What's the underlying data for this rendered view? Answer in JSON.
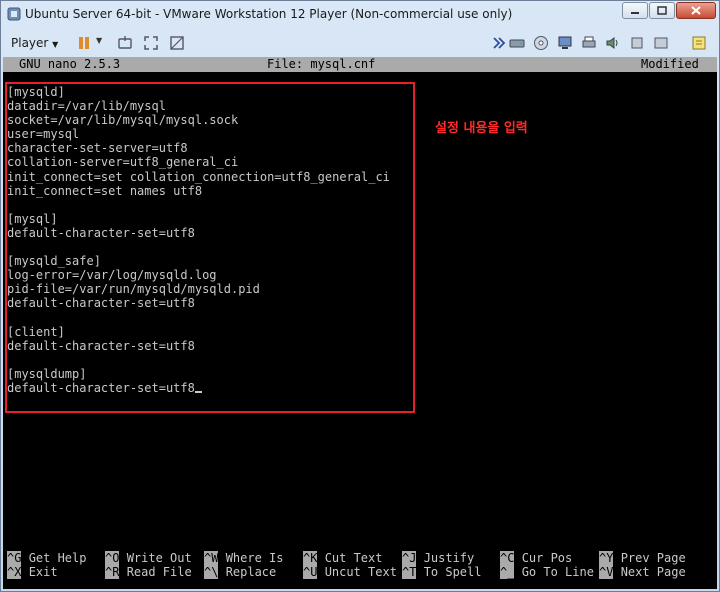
{
  "window": {
    "title": "Ubuntu Server 64-bit - VMware Workstation 12 Player (Non-commercial use only)"
  },
  "toolbar": {
    "player_label": "Player",
    "icons": [
      "pause-icon",
      "send-keys-icon",
      "fullscreen-icon",
      "unity-icon",
      "forward-icon",
      "hard-disk-icon",
      "cd-icon",
      "network-icon",
      "printer-icon",
      "sound-icon",
      "usb-icon",
      "display-icon",
      "notes-icon"
    ]
  },
  "nano": {
    "header": {
      "app": "GNU nano 2.5.3",
      "file": "File: mysql.cnf",
      "status": "Modified"
    },
    "lines": [
      "[mysqld]",
      "datadir=/var/lib/mysql",
      "socket=/var/lib/mysql/mysql.sock",
      "user=mysql",
      "character-set-server=utf8",
      "collation-server=utf8_general_ci",
      "init_connect=set collation_connection=utf8_general_ci",
      "init_connect=set names utf8",
      "",
      "[mysql]",
      "default-character-set=utf8",
      "",
      "[mysqld_safe]",
      "log-error=/var/log/mysqld.log",
      "pid-file=/var/run/mysqld/mysqld.pid",
      "default-character-set=utf8",
      "",
      "[client]",
      "default-character-set=utf8",
      "",
      "[mysqldump]",
      "default-character-set=utf8"
    ],
    "annotation": "설정 내용을 입력",
    "shortcuts_row1": [
      {
        "key": "^G",
        "label": "Get Help"
      },
      {
        "key": "^O",
        "label": "Write Out"
      },
      {
        "key": "^W",
        "label": "Where Is"
      },
      {
        "key": "^K",
        "label": "Cut Text"
      },
      {
        "key": "^J",
        "label": "Justify"
      },
      {
        "key": "^C",
        "label": "Cur Pos"
      },
      {
        "key": "^Y",
        "label": "Prev Page"
      }
    ],
    "shortcuts_row2": [
      {
        "key": "^X",
        "label": "Exit"
      },
      {
        "key": "^R",
        "label": "Read File"
      },
      {
        "key": "^\\",
        "label": "Replace"
      },
      {
        "key": "^U",
        "label": "Uncut Text"
      },
      {
        "key": "^T",
        "label": "To Spell"
      },
      {
        "key": "^_",
        "label": "Go To Line"
      },
      {
        "key": "^V",
        "label": "Next Page"
      }
    ]
  }
}
